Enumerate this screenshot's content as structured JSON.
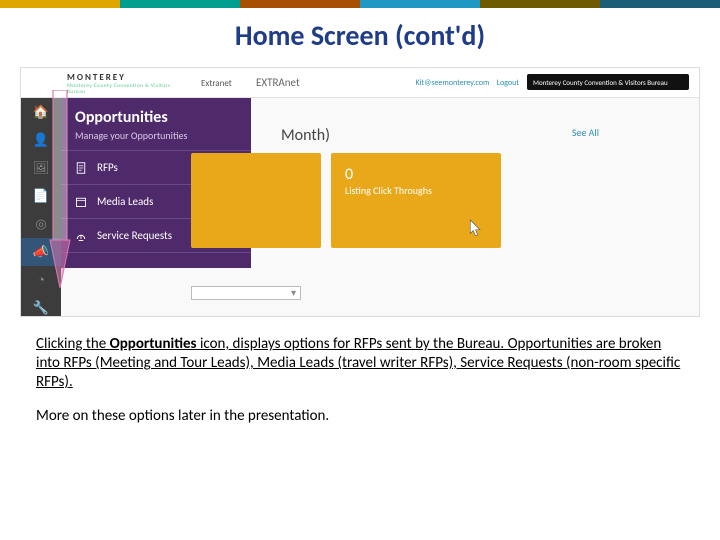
{
  "colorbar": [
    "#e0a600",
    "#009e8f",
    "#a64f00",
    "#1f98c3",
    "#6e5b00",
    "#1a5e78"
  ],
  "title": "Home Screen (cont'd)",
  "mock": {
    "logo_brand": "MONTEREY",
    "logo_tag": "Monterey County Convention & Visitors Bureau",
    "extranet_small": "Extranet",
    "extranet_big": "EXTRAnet",
    "user_email": "Kit@seemonterey.com",
    "logout": "Logout",
    "blackbar_text": "Monterey County Convention & Visitors Bureau",
    "flyout": {
      "title": "Opportunities",
      "subtitle": "Manage your Opportunities",
      "items": [
        "RFPs",
        "Media Leads",
        "Service Requests"
      ]
    },
    "main_label": "Month)",
    "see_all": "See All",
    "card": {
      "num": "0",
      "label": "Listing Click Throughs"
    }
  },
  "body": {
    "p1_a": "Clicking the ",
    "p1_b": "Opportunities",
    "p1_c": " icon, displays options for RFPs sent by the Bureau. Opportunities are broken into RFPs (Meeting and Tour Leads), Media Leads (travel writer RFPs), Service Requests (non-room specific RFPs).",
    "p2": "More on these options later in the presentation."
  }
}
